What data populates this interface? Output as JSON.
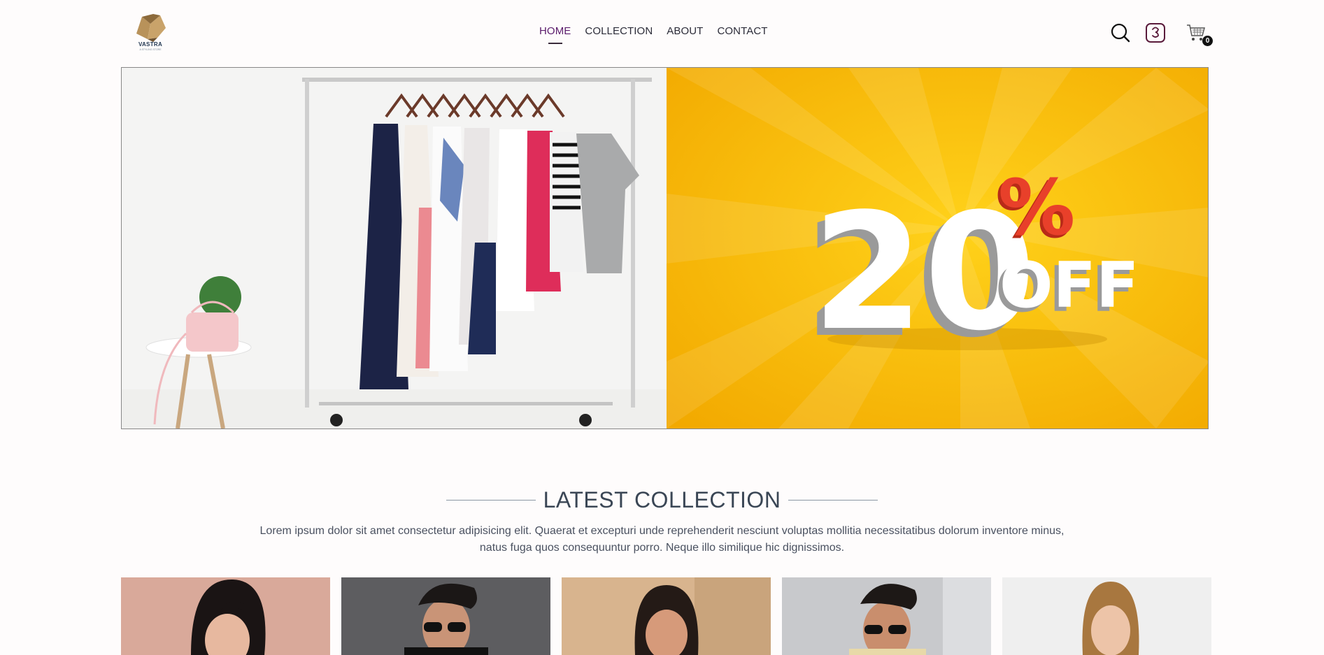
{
  "header": {
    "logo": {
      "name": "VASTRA",
      "tagline": "A STYLING STORE"
    },
    "nav": [
      {
        "label": "HOME",
        "active": true
      },
      {
        "label": "COLLECTION",
        "active": false
      },
      {
        "label": "ABOUT",
        "active": false
      },
      {
        "label": "CONTACT",
        "active": false
      }
    ],
    "icons": [
      "search-icon",
      "profile-icon",
      "cart-icon"
    ],
    "cart_count": "0"
  },
  "hero": {
    "left_image": "clothing-rack-photo",
    "right_banner": {
      "number": "20",
      "percent": "%",
      "off": "OFF"
    },
    "colors": {
      "banner_bg": "#f7b500",
      "percent": "#e8402a"
    }
  },
  "latest_collection": {
    "title": "LATEST COLLECTION",
    "description": "Lorem ipsum dolor sit amet consectetur adipisicing elit. Quaerat et excepturi unde reprehenderit nesciunt voluptas mollitia necessitatibus dolorum inventore minus, natus fuga quos consequuntur porro. Neque illo similique hic dignissimos.",
    "products": [
      {
        "image": "woman-pink-backdrop"
      },
      {
        "image": "man-sunglasses-grey-backdrop"
      },
      {
        "image": "woman-beige-backdrop"
      },
      {
        "image": "man-sunglasses-light-backdrop"
      },
      {
        "image": "woman-white-backdrop"
      }
    ]
  },
  "colors": {
    "accent": "#5a1b6b",
    "text": "#3a4655"
  }
}
